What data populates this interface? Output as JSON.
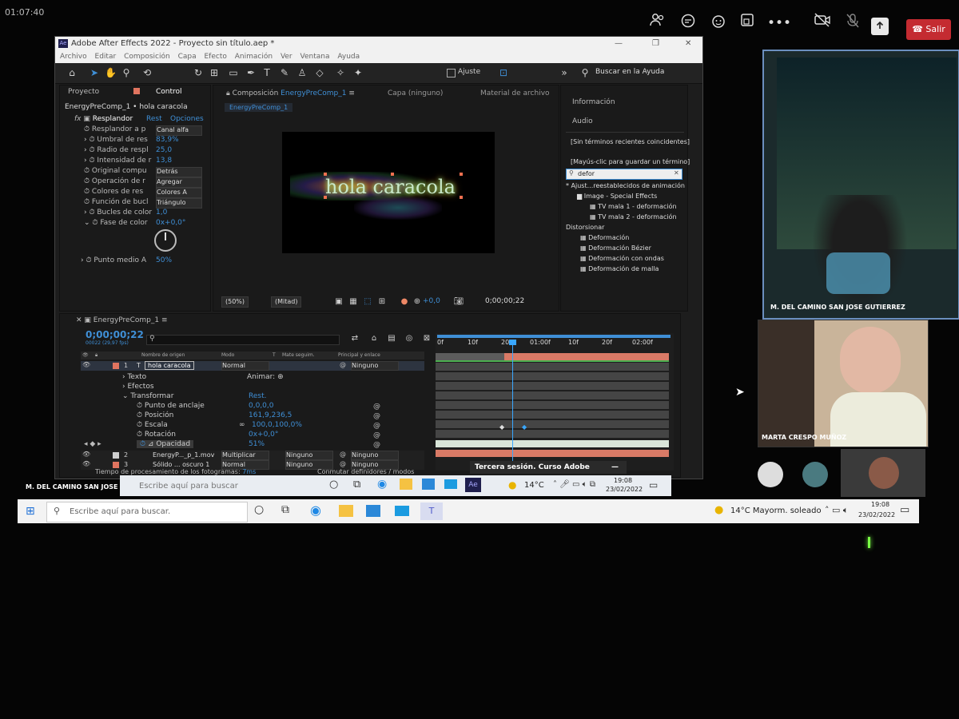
{
  "meeting": {
    "clock": "01:07:40",
    "toolbar_icons": [
      "people-icon",
      "chat-icon",
      "reactions-icon",
      "share-tray-icon",
      "more-icon",
      "camera-off-icon",
      "mic-off-icon",
      "share-icon"
    ],
    "more_label": "•••",
    "leave_label": "Salir",
    "caption_bar": "Tercera sesión. Curso Adobe",
    "presenter_label": "M. DEL CAMINO SAN JOSE GUTIERREZ",
    "participants": [
      {
        "name": "M. DEL CAMINO SAN JOSE GUTIERREZ"
      },
      {
        "name": "MARTA CRESPO MUÑOZ"
      }
    ]
  },
  "ae": {
    "title": "Adobe After Effects 2022 - Proyecto sin título.aep *",
    "menu": [
      "Archivo",
      "Editar",
      "Composición",
      "Capa",
      "Efecto",
      "Animación",
      "Ver",
      "Ventana",
      "Ayuda"
    ],
    "toolbar": {
      "ajuste_label": "Ajuste",
      "help_search": "Buscar en la Ayuda"
    },
    "left_panel": {
      "tabs": [
        "Proyecto",
        "Control"
      ],
      "header": "EnergyPreComp_1 • hola caracola",
      "effect_name": "Resplandor",
      "effect_reset": "Rest",
      "effect_options": "Opciones",
      "props": [
        {
          "label": "Resplandor a p",
          "value": "Canal alfa"
        },
        {
          "label": "Umbral de res",
          "value": "83,9%"
        },
        {
          "label": "Radio de respl",
          "value": "25,0"
        },
        {
          "label": "Intensidad de r",
          "value": "13,8"
        },
        {
          "label": "Original compu",
          "value": "Detrás"
        },
        {
          "label": "Operación de r",
          "value": "Agregar"
        },
        {
          "label": "Colores de res",
          "value": "Colores A"
        },
        {
          "label": "Función de bucl",
          "value": "Triángulo"
        },
        {
          "label": "Bucles de color",
          "value": "1,0"
        },
        {
          "label": "Fase de color",
          "value": "0x+0,0°"
        }
      ],
      "midpoint_label": "Punto medio A",
      "midpoint_value": "50%"
    },
    "comp_panel": {
      "tab_prefix": "Composición",
      "tab_name": "EnergyPreComp_1",
      "subtab": "EnergyPreComp_1",
      "layer_tab": "Capa (ninguno)",
      "footage_tab": "Material de archivo",
      "viewer_text": "hola caracola",
      "zoom": "(50%)",
      "resolution": "(Mitad)",
      "exposure": "+0,0",
      "timecode": "0;00;00;22"
    },
    "right_panel": {
      "items": [
        "Información",
        "Audio"
      ],
      "no_recent": "[Sin términos recientes coincidentes]",
      "save_hint": "[Mayús-clic para guardar un término]",
      "search_value": "defor",
      "tree": [
        "* Ajust...reestablecidos de animación",
        "Image - Special Effects",
        "TV mala 1 - deformación",
        "TV mala 2 - deformación",
        "Distorsionar",
        "Deformación",
        "Deformación Bézier",
        "Deformación con ondas",
        "Deformación de malla"
      ]
    },
    "timeline": {
      "tab": "EnergyPreComp_1",
      "timecode": "0;00;00;22",
      "fps": "00022 (29,97 fps)",
      "col_headers": [
        "Nombre de origen",
        "Modo",
        "T",
        "Mate seguim.",
        "Principal y enlace"
      ],
      "ruler": [
        "0f",
        "10f",
        "20f",
        "01:00f",
        "10f",
        "20f",
        "02:00f"
      ],
      "layers": [
        {
          "num": "1",
          "name": "hola caracola",
          "mode": "Normal",
          "matte": "",
          "parent": "Ninguno",
          "color": "#e0745f"
        },
        {
          "num": "2",
          "name": "EnergyP..._p_1.mov",
          "mode": "Multiplicar",
          "matte": "Ninguno",
          "parent": "Ninguno",
          "color": "#cfcfcf"
        },
        {
          "num": "3",
          "name": "Sólido ... oscuro 1",
          "mode": "Normal",
          "matte": "Ninguno",
          "parent": "Ninguno",
          "color": "#e0745f"
        }
      ],
      "groups": [
        "Texto",
        "Efectos",
        "Transformar"
      ],
      "animate_label": "Animar:",
      "transform_reset": "Rest.",
      "transform_props": [
        {
          "label": "Punto de anclaje",
          "value": "0,0,0,0"
        },
        {
          "label": "Posición",
          "value": "161,9,236,5"
        },
        {
          "label": "Escala",
          "value": "100,0,100,0%"
        },
        {
          "label": "Rotación",
          "value": "0x+0,0°"
        },
        {
          "label": "Opacidad",
          "value": "51%"
        }
      ],
      "footer_time_label": "Tiempo de procesamiento de los fotogramas:",
      "footer_time_value": "7ms",
      "footer_toggle": "Conmutar definidores / modos"
    }
  },
  "virtual_taskbar": {
    "search_placeholder": "Escribe aquí para buscar",
    "temp": "14°C",
    "time": "19:08",
    "date": "23/02/2022"
  },
  "taskbar": {
    "search_placeholder": "Escribe aquí para buscar.",
    "weather": "14°C  Mayorm. soleado",
    "time": "19:08",
    "date": "23/02/2022"
  },
  "colors": {
    "ae_blue": "#3f8fd6",
    "leave_red": "#c42b31",
    "playhead": "#39a7ff"
  }
}
